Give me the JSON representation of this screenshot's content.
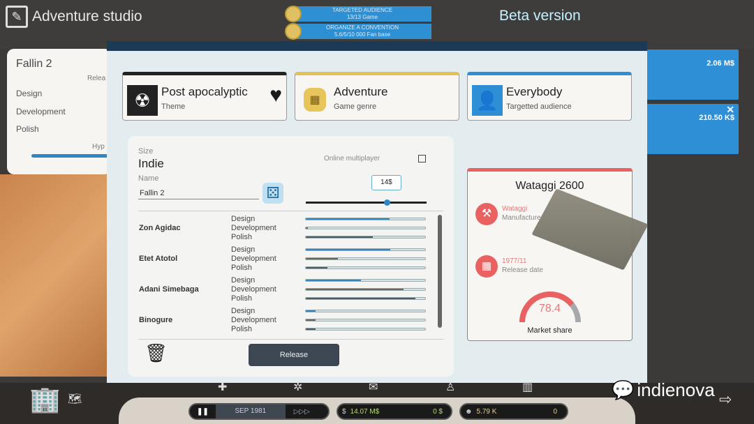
{
  "header": {
    "studio_name": "Adventure studio",
    "beta_label": "Beta version",
    "quests": [
      {
        "title": "TARGETED AUDIENCE",
        "detail": "13/13 Game"
      },
      {
        "title": "ORGANIZE A CONVENTION",
        "detail": "5.6/5/10 000 Fan base"
      }
    ]
  },
  "left_panel": {
    "title": "Fallin 2",
    "release_label": "Relea",
    "rows": [
      "Design",
      "Development",
      "Polish"
    ],
    "hype_label": "Hyp"
  },
  "right_cards": [
    {
      "value": "2.06 M$"
    },
    {
      "value": "210.50 K$"
    }
  ],
  "top_cards": [
    {
      "main": "Post apocalyptic",
      "sub": "Theme",
      "icon": "radiation-icon",
      "accent": "#222222",
      "favorite": true
    },
    {
      "main": "Adventure",
      "sub": "Game genre",
      "icon": "map-icon",
      "accent": "#e2c15c"
    },
    {
      "main": "Everybody",
      "sub": "Targetted audience",
      "icon": "user-heart-icon",
      "accent": "#2f8fd6"
    }
  ],
  "game": {
    "size_label": "Size",
    "size_value": "Indie",
    "name_label": "Name",
    "name_value": "Fallin 2",
    "multiplayer_label": "Online multiplayer",
    "multiplayer_checked": false,
    "price_label": "14$",
    "price_slider_fraction": 0.67,
    "release_label": "Release"
  },
  "staff": [
    {
      "name": "Zon Agidac",
      "skills": [
        {
          "label": "Design",
          "value": 0.7
        },
        {
          "label": "Development",
          "value": 0.02
        },
        {
          "label": "Polish",
          "value": 0.56
        }
      ]
    },
    {
      "name": "Etet Atotol",
      "skills": [
        {
          "label": "Design",
          "value": 0.71
        },
        {
          "label": "Development",
          "value": 0.27
        },
        {
          "label": "Polish",
          "value": 0.18
        }
      ]
    },
    {
      "name": "Adani Simebaga",
      "skills": [
        {
          "label": "Design",
          "value": 0.46
        },
        {
          "label": "Development",
          "value": 0.82
        },
        {
          "label": "Polish",
          "value": 0.92
        }
      ]
    },
    {
      "name": "Binogure",
      "skills": [
        {
          "label": "Design",
          "value": 0.08
        },
        {
          "label": "Development",
          "value": 0.08
        },
        {
          "label": "Polish",
          "value": 0.08
        }
      ]
    }
  ],
  "skill_colors": {
    "Design": "#2f86c4",
    "Development": "#6b6558",
    "Polish": "#4d5b66"
  },
  "console": {
    "name": "Wataggi 2600",
    "manufacturer": "Wataggi",
    "manufacturer_label": "Manufacturer",
    "release_date": "1977/11",
    "release_label": "Release date",
    "market_share": 78.4,
    "market_share_label": "Market share",
    "accent": "#e96161"
  },
  "bottom": {
    "date": "SEP 1981",
    "money": "14.07 M$",
    "money_delta": "0 $",
    "fans": "5.79 K",
    "fans_delta": "0"
  },
  "watermark": "indienova"
}
